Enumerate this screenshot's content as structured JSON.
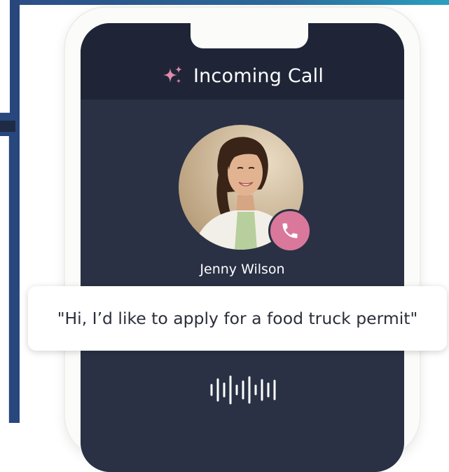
{
  "call": {
    "title": "Incoming Call",
    "caller_name": "Jenny Wilson",
    "transcript": "\"Hi, I’d like to apply for a food truck permit\""
  },
  "icons": {
    "title_icon": "sparkle-icon",
    "badge_icon": "phone-icon",
    "audio_icon": "waveform-icon"
  },
  "colors": {
    "screen_bg": "#2a3144",
    "header_bg": "#1f2537",
    "accent_pink": "#d9789b",
    "page_blue": "#27477d"
  }
}
